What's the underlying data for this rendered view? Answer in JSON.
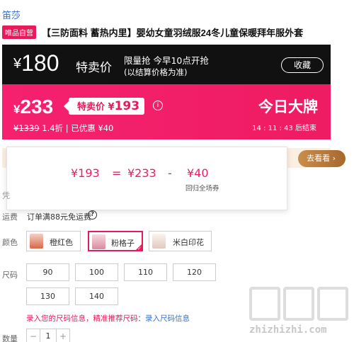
{
  "brand": "笛莎",
  "title": {
    "badge": "唯品自营",
    "text": "【三防面料 蓄热内里】婴幼女童羽绒服24冬儿童保暖拜年服外套"
  },
  "flash_band": {
    "currency": "¥",
    "price": "180",
    "tag": "特卖价",
    "line1": "限量抢 今早10点开抢",
    "line2": "(以结算价格为准)",
    "favorite_label": "收藏"
  },
  "sale_band": {
    "currency": "¥",
    "price": "233",
    "tag_label": "特卖价",
    "tag_currency": "¥",
    "tag_price": "193",
    "info_icon": "i",
    "original_price": "¥1339",
    "discount": "1.4折",
    "separator": "|",
    "saved": "已优惠 ¥40",
    "brand_day": "今日大牌",
    "countdown": "14 : 11 : 43",
    "countdown_suffix": "后结束"
  },
  "hint_button": "去看看",
  "popup": {
    "final": "¥193",
    "eq": "=",
    "base": "¥233",
    "minus": "-",
    "coupon": "¥40",
    "coupon_note": "回归全场券"
  },
  "shipping": {
    "hidden_label": "凭",
    "label": "运费",
    "value": "订单满88元免运费",
    "help_icon": "?"
  },
  "colors": {
    "label": "颜色",
    "options": [
      {
        "name": "橙红色",
        "selected": false,
        "swatch": "#e07a5f"
      },
      {
        "name": "粉格子",
        "selected": true,
        "swatch": "#e9a3b6"
      },
      {
        "name": "米白印花",
        "selected": false,
        "swatch": "#f0e5de"
      }
    ],
    "selected_check": "✓"
  },
  "sizes": {
    "label": "尺码",
    "options": [
      "90",
      "100",
      "110",
      "120",
      "130",
      "140"
    ],
    "hint": "录入您的尺码信息，精准推荐尺码：",
    "hint_link": "录入尺码信息"
  },
  "quantity": {
    "label": "数量",
    "minus": "−",
    "value": "1",
    "plus": "+"
  },
  "watermark": "zhizhizhi.com",
  "theme": {
    "accent": "#e81a5a",
    "dark": "#111111",
    "link": "#3a6fcf",
    "gold": "#b07535"
  }
}
